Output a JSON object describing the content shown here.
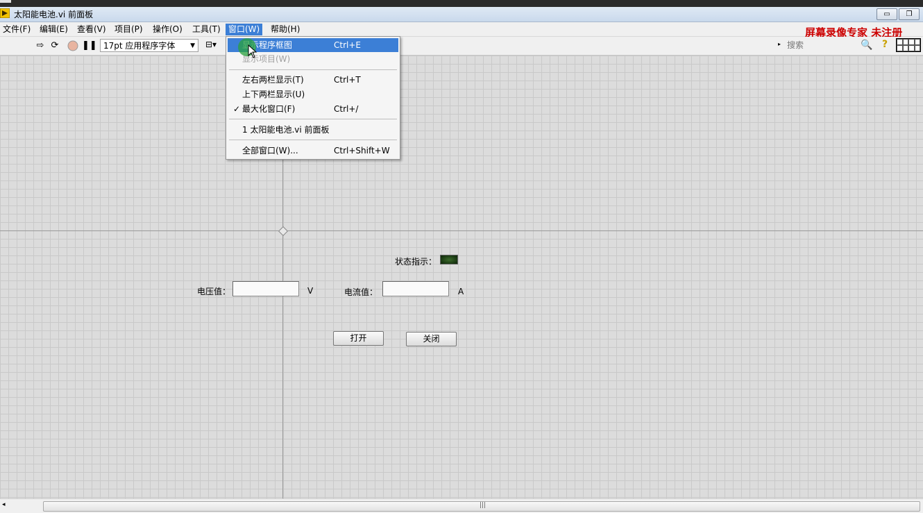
{
  "window": {
    "title": "太阳能电池.vi 前面板"
  },
  "menubar": {
    "items": [
      {
        "label": "文件(F)"
      },
      {
        "label": "编辑(E)"
      },
      {
        "label": "查看(V)"
      },
      {
        "label": "项目(P)"
      },
      {
        "label": "操作(O)"
      },
      {
        "label": "工具(T)"
      },
      {
        "label": "窗口(W)"
      },
      {
        "label": "帮助(H)"
      }
    ],
    "active": "窗口(W)"
  },
  "watermark": "屏幕录像专家 未注册",
  "toolbar": {
    "font_select": "17pt 应用程序字体",
    "search_placeholder": "搜索"
  },
  "window_menu": {
    "items": [
      {
        "label": "显示程序框图",
        "shortcut": "Ctrl+E",
        "state": "highlighted"
      },
      {
        "label": "显示项目(W)",
        "shortcut": "",
        "state": "disabled"
      },
      {
        "label": "左右两栏显示(T)",
        "shortcut": "Ctrl+T",
        "state": "normal"
      },
      {
        "label": "上下两栏显示(U)",
        "shortcut": "",
        "state": "normal"
      },
      {
        "label": "最大化窗口(F)",
        "shortcut": "Ctrl+/",
        "state": "checked"
      },
      {
        "label": "1 太阳能电池.vi 前面板",
        "shortcut": "",
        "state": "normal"
      },
      {
        "label": "全部窗口(W)...",
        "shortcut": "Ctrl+Shift+W",
        "state": "normal"
      }
    ],
    "check_mark": "✓"
  },
  "front_panel": {
    "status_label": "状态指示：",
    "voltage_label": "电压值：",
    "voltage_value": "",
    "voltage_unit": "V",
    "current_label": "电流值：",
    "current_value": "",
    "current_unit": "A",
    "open_button": "打开",
    "close_button": "关闭",
    "led_on": false
  },
  "colors": {
    "menu_highlight": "#3c7fd6",
    "watermark": "#cc0000",
    "led_dark_green": "#0c2408"
  }
}
